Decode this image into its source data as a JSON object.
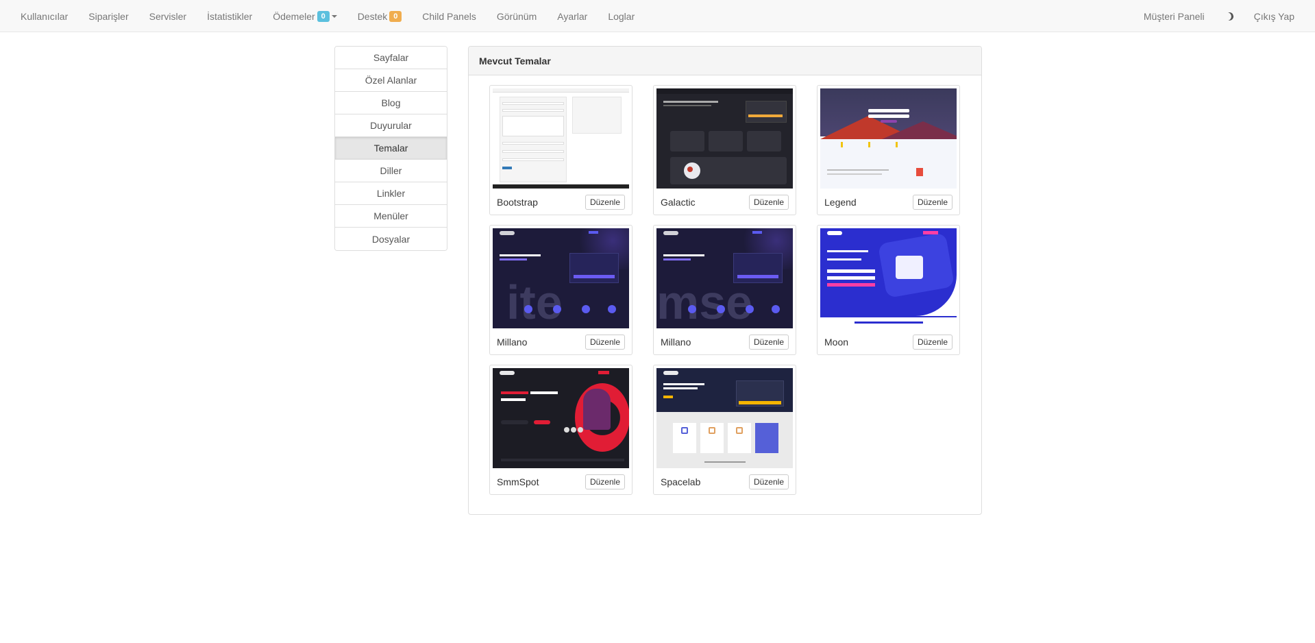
{
  "nav": {
    "left": [
      {
        "label": "Kullanıcılar"
      },
      {
        "label": "Siparişler"
      },
      {
        "label": "Servisler"
      },
      {
        "label": "İstatistikler"
      },
      {
        "label": "Ödemeler",
        "badge": "0",
        "badge_color": "#5bc0de",
        "dropdown": true
      },
      {
        "label": "Destek",
        "badge": "0",
        "badge_color": "#f0ad4e"
      },
      {
        "label": "Child Panels"
      },
      {
        "label": "Görünüm"
      },
      {
        "label": "Ayarlar"
      },
      {
        "label": "Loglar"
      }
    ],
    "right": {
      "client_panel": "Müşteri Paneli",
      "theme_toggle_icon": "moon-icon",
      "logout": "Çıkış Yap"
    }
  },
  "sidebar": {
    "items": [
      {
        "label": "Sayfalar"
      },
      {
        "label": "Özel Alanlar"
      },
      {
        "label": "Blog"
      },
      {
        "label": "Duyurular"
      },
      {
        "label": "Temalar",
        "active": true
      },
      {
        "label": "Diller"
      },
      {
        "label": "Linkler"
      },
      {
        "label": "Menüler"
      },
      {
        "label": "Dosyalar"
      }
    ]
  },
  "themes": {
    "title": "Mevcut Temalar",
    "edit_label": "Düzenle",
    "items": [
      {
        "name": "Bootstrap",
        "preview": "light"
      },
      {
        "name": "Galactic",
        "preview": "dark-grey"
      },
      {
        "name": "Legend",
        "preview": "purple-mountain"
      },
      {
        "name": "Millano",
        "preview": "navy"
      },
      {
        "name": "Millano",
        "preview": "navy"
      },
      {
        "name": "Moon",
        "preview": "blue-wave"
      },
      {
        "name": "SmmSpot",
        "preview": "dark-red"
      },
      {
        "name": "Spacelab",
        "preview": "navy-cards"
      }
    ]
  },
  "colors": {
    "navbar_bg": "#f8f8f8",
    "active_menu_bg": "#e6e6e6",
    "badge_info": "#5bc0de",
    "badge_warning": "#f0ad4e"
  }
}
